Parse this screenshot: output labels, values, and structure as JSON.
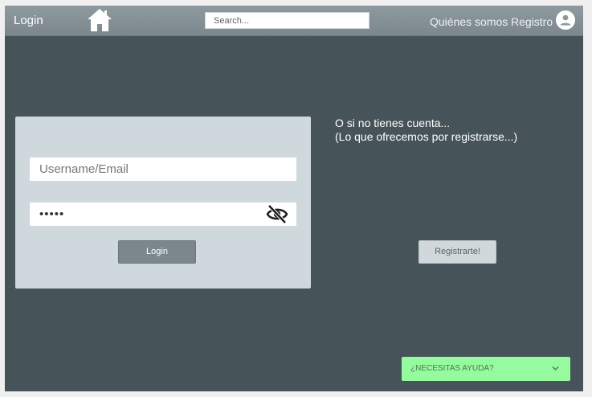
{
  "navbar": {
    "login_label": "Login",
    "search_placeholder": "Search...",
    "about_label": "Quiénes somos",
    "register_label": "Registro"
  },
  "login_form": {
    "username_placeholder": "Username/Email",
    "password_value": "•••••",
    "submit_label": "Login"
  },
  "register_panel": {
    "line1": "O si no tienes cuenta...",
    "line2": "(Lo que ofrecemos por registrarse...)",
    "button_label": "Registrarte!"
  },
  "help_widget": {
    "label": "¿NECESITAS AYUDA?"
  },
  "icons": {
    "home": "home-icon",
    "avatar": "account-circle-icon",
    "password_toggle": "eye-off-icon",
    "help_toggle": "chevron-down-icon"
  },
  "colors": {
    "navbar": "#8a969b",
    "background": "#465358",
    "card": "#cfd8dc",
    "login_button": "#7c878c",
    "help_widget": "#96fa9e"
  }
}
